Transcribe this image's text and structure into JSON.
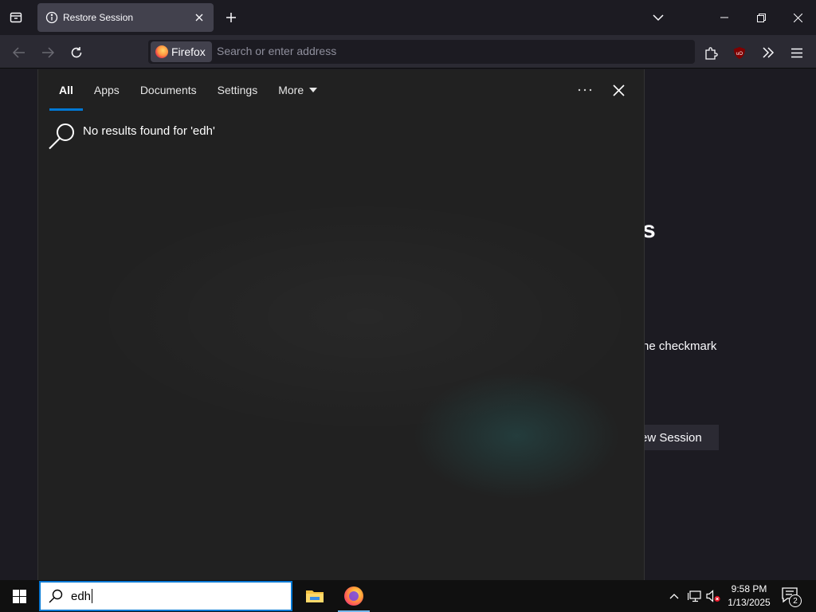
{
  "browser": {
    "tab_title": "Restore Session",
    "identity_label": "Firefox",
    "address_placeholder": "Search or enter address"
  },
  "page": {
    "heading_fragment": "s",
    "text_fragment": "he checkmark",
    "button_fragment": "ew Session"
  },
  "search_flyout": {
    "tabs": [
      {
        "label": "All",
        "active": true
      },
      {
        "label": "Apps",
        "active": false
      },
      {
        "label": "Documents",
        "active": false
      },
      {
        "label": "Settings",
        "active": false
      },
      {
        "label": "More",
        "active": false
      }
    ],
    "no_results_message": "No results found for 'edh'"
  },
  "taskbar": {
    "search_query": "edh",
    "clock_time": "9:58 PM",
    "clock_date": "1/13/2025",
    "notification_count": "2"
  },
  "colors": {
    "accent": "#0078d4",
    "panel_bg": "#212121",
    "taskbar_bg": "#101010",
    "browser_bg": "#1c1b22"
  }
}
